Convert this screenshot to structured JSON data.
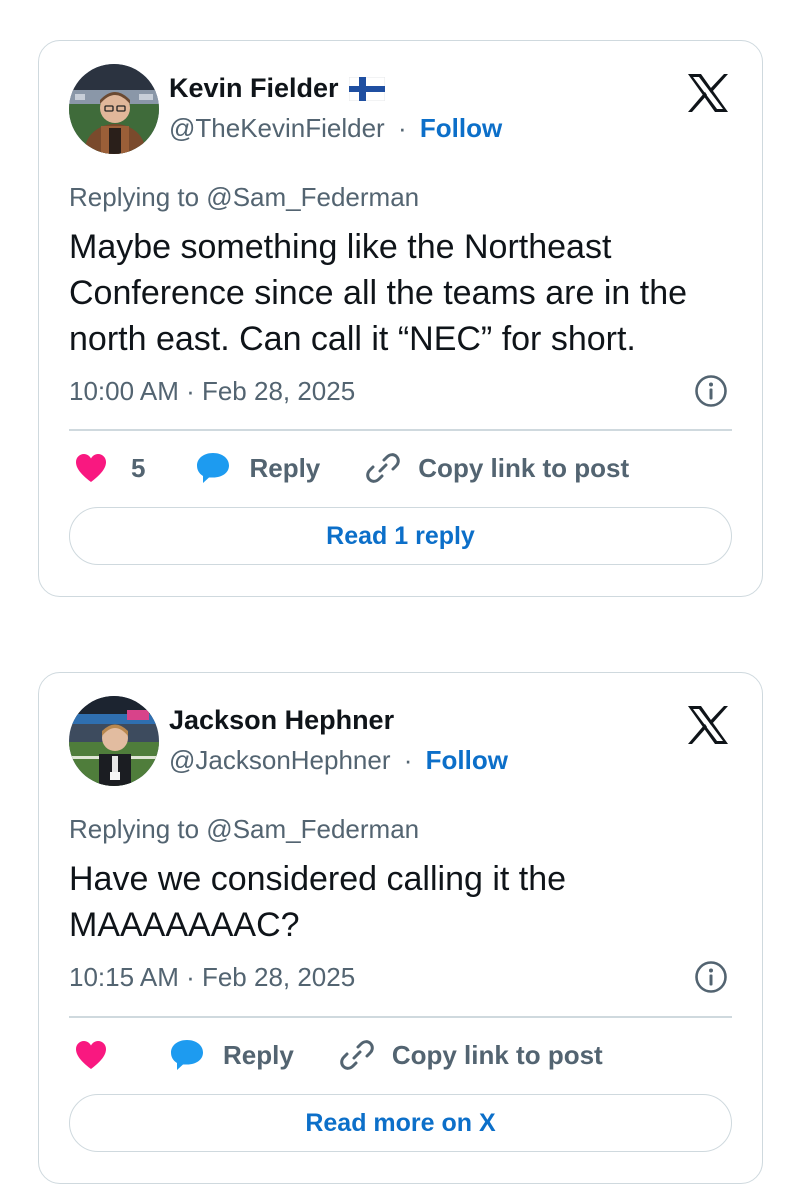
{
  "colors": {
    "link_blue": "#0c6fc9",
    "secondary_text": "#536471",
    "border": "#cfd9de",
    "heart_pink": "#f91880",
    "reply_blue": "#1d9bf0"
  },
  "tweets": [
    {
      "author_name": "Kevin Fielder",
      "author_flag": "finland-flag-icon",
      "handle": "@TheKevinFielder",
      "separator": "·",
      "follow_label": "Follow",
      "replying_to": "Replying to @Sam_Federman",
      "text": "Maybe something like the Northeast Conference since all the teams are in the north east. Can call it “NEC” for short.",
      "timestamp": "10:00 AM · Feb 28, 2025",
      "like_count": "5",
      "reply_label": "Reply",
      "copy_label": "Copy link to post",
      "read_label": "Read 1 reply"
    },
    {
      "author_name": "Jackson Hephner",
      "handle": "@JacksonHephner",
      "separator": "·",
      "follow_label": "Follow",
      "replying_to": "Replying to @Sam_Federman",
      "text": "Have we considered calling it the MAAAAAAAC?",
      "timestamp": "10:15 AM · Feb 28, 2025",
      "like_count": "",
      "reply_label": "Reply",
      "copy_label": "Copy link to post",
      "read_label": "Read more on X"
    }
  ]
}
